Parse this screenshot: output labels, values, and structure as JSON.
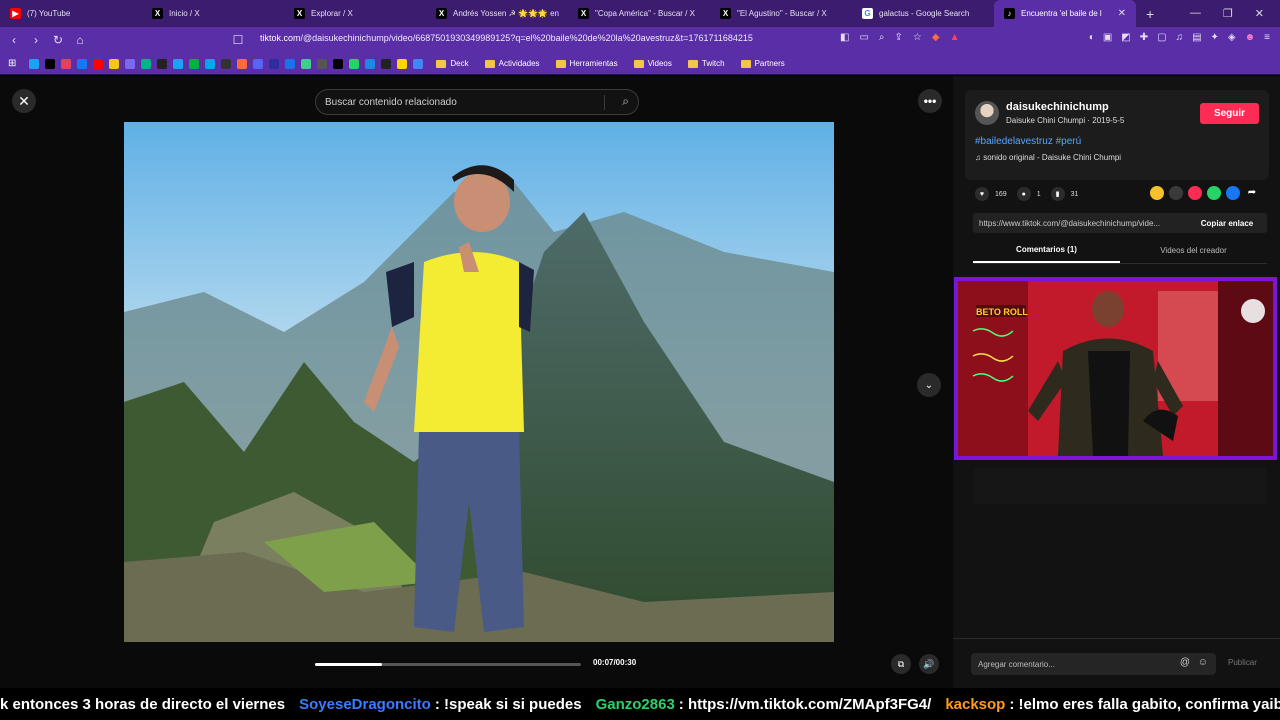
{
  "browser": {
    "tabs": [
      {
        "title": "(7) YouTube",
        "icon": "youtube-icon",
        "color": "#ff0000",
        "glyph": "▶"
      },
      {
        "title": "Inicio / X",
        "icon": "x-icon",
        "color": "#000000",
        "glyph": "X"
      },
      {
        "title": "Explorar / X",
        "icon": "x-icon",
        "color": "#000000",
        "glyph": "X"
      },
      {
        "title": "Andrés Yossen ☭ 🌟🌟🌟 en",
        "icon": "x-icon",
        "color": "#000000",
        "glyph": "X"
      },
      {
        "title": "\"Copa América\" - Buscar / X",
        "icon": "x-icon",
        "color": "#000000",
        "glyph": "X"
      },
      {
        "title": "\"El Agustino\" - Buscar / X",
        "icon": "x-icon",
        "color": "#000000",
        "glyph": "X"
      },
      {
        "title": "galactus - Google Search",
        "icon": "google-icon",
        "color": "#ffffff",
        "glyph": "G"
      },
      {
        "title": "Encuentra 'el baile de l",
        "icon": "tiktok-icon",
        "color": "#000000",
        "glyph": "♪"
      }
    ],
    "active_tab_close": "✕",
    "new_tab": "+",
    "url_domain": "tiktok.com",
    "url_path": "/@daisukechinichump/video/6687501930349989125?q=el%20baile%20de%20la%20avestruz&t=1761711684215",
    "bookmark_folders": [
      "Deck",
      "Actividades",
      "Herramientas",
      "Videos",
      "Twitch",
      "Partners"
    ],
    "bookmark_icon_colors": [
      "#1da1f2",
      "#000000",
      "#e4405f",
      "#1877f2",
      "#ff0000",
      "#f5c518",
      "#7b68ee",
      "#00b488",
      "#222222",
      "#1da1f2",
      "#00b341",
      "#00a8e8",
      "#333333",
      "#ff6a3d",
      "#5865f2",
      "#2d2d9f",
      "#1a73e8",
      "#3ecf8e",
      "#555555",
      "#000000",
      "#25d366",
      "#1e88e5",
      "#222222",
      "#ffd400",
      "#4285f4"
    ]
  },
  "player": {
    "search_placeholder": "Buscar contenido relacionado",
    "time": "00:07/00:30",
    "progress_fraction": 0.25
  },
  "sidebar": {
    "username": "daisukechinichump",
    "subline": "Daisuke Chini Chumpi · 2019-5-5",
    "follow_label": "Seguir",
    "tags": "#bailedelavestruz #perú",
    "sound": "sonido original - Daisuke Chini Chumpi",
    "likes": "169",
    "comments": "1",
    "saves": "31",
    "link": "https://www.tiktok.com/@daisukechinichump/vide...",
    "copy_label": "Copiar enlace",
    "tab_comments": "Comentarios (1)",
    "tab_creator": "Videos del creador",
    "comment_placeholder": "Agregar comentario...",
    "publish_label": "Publicar"
  },
  "overlay": {
    "brand": "BETO ROLL"
  },
  "chat": [
    {
      "nick": "",
      "color": "#ffffff",
      "text": "k entonces 3 horas de directo el viernes"
    },
    {
      "nick": "SoyeseDragoncito",
      "color": "#3d7bff",
      "text": ": !speak si si puedes"
    },
    {
      "nick": "Ganzo2863",
      "color": "#2bd16a",
      "text": ": https://vm.tiktok.com/ZMApf3FG4/"
    },
    {
      "nick": "kacksop",
      "color": "#ff9a1f",
      "text": ": !elmo eres falla gabito, confirma yaiblack"
    }
  ]
}
